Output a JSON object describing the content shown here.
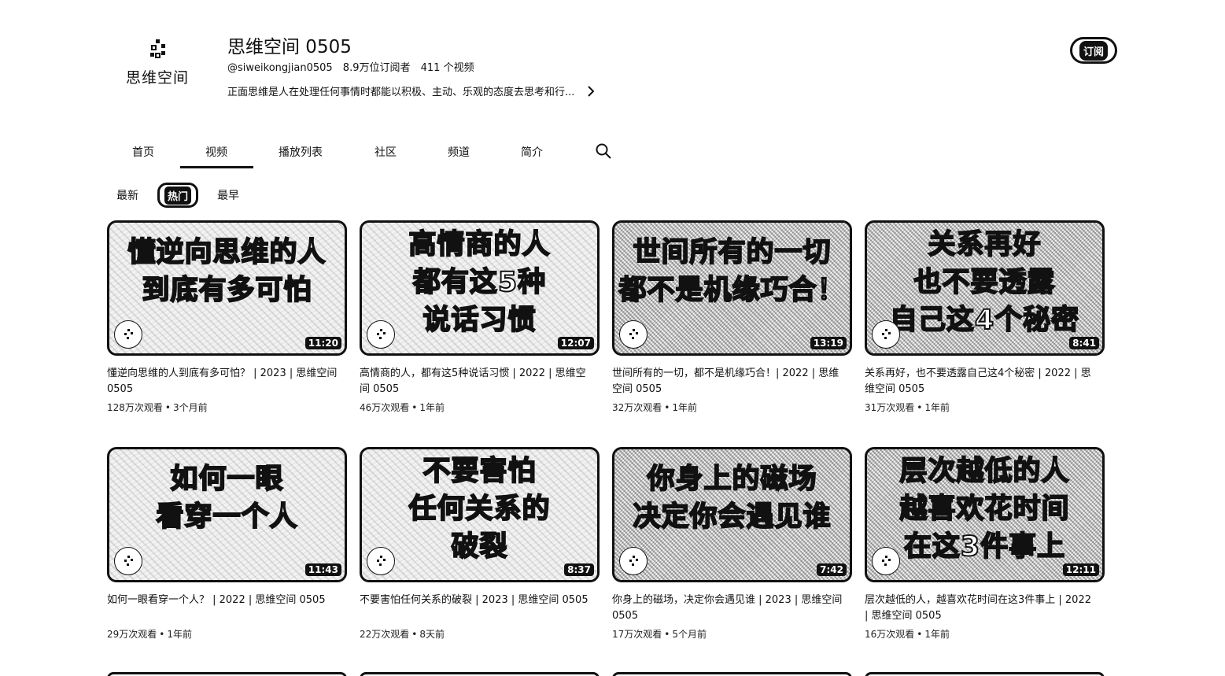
{
  "channel": {
    "logo_text": "思维空间",
    "title": "思维空间 0505",
    "handle": "@siweikongjian0505",
    "subscribers": "8.9万位订阅者",
    "video_count": "411 个视频",
    "description": "正面思维是人在处理任何事情时都能以积极、主动、乐观的态度去思考和行...",
    "subscribe_label": "订阅"
  },
  "tabs": [
    {
      "label": "首页"
    },
    {
      "label": "视频",
      "active": true
    },
    {
      "label": "播放列表"
    },
    {
      "label": "社区"
    },
    {
      "label": "频道"
    },
    {
      "label": "简介"
    }
  ],
  "sort": {
    "latest": "最新",
    "popular": "热门",
    "oldest": "最早"
  },
  "videos": [
    {
      "thumb_lines": [
        "懂逆向思维的人",
        "到底有多可怕"
      ],
      "duration": "11:20",
      "title": "懂逆向思维的人到底有多可怕？ | 2023 | 思维空间 0505",
      "views": "128万次观看",
      "age": "3个月前"
    },
    {
      "thumb_lines": [
        "高情商的人",
        "都有这5种",
        "说话习惯"
      ],
      "duration": "12:07",
      "title": "高情商的人，都有这5种说话习惯 | 2022 | 思维空间 0505",
      "views": "46万次观看",
      "age": "1年前"
    },
    {
      "thumb_lines": [
        "世间所有的一切",
        "都不是机缘巧合！"
      ],
      "duration": "13:19",
      "title": "世间所有的一切，都不是机缘巧合！| 2022 | 思维空间 0505",
      "views": "32万次观看",
      "age": "1年前"
    },
    {
      "thumb_lines": [
        "关系再好",
        "也不要透露",
        "自己这4个秘密"
      ],
      "duration": "8:41",
      "title": "关系再好，也不要透露自己这4个秘密 | 2022 | 思维空间 0505",
      "views": "31万次观看",
      "age": "1年前"
    },
    {
      "thumb_lines": [
        "如何一眼",
        "看穿一个人"
      ],
      "duration": "11:43",
      "title": "如何一眼看穿一个人？ | 2022 | 思维空间 0505",
      "views": "29万次观看",
      "age": "1年前"
    },
    {
      "thumb_lines": [
        "不要害怕",
        "任何关系的",
        "破裂"
      ],
      "duration": "8:37",
      "title": "不要害怕任何关系的破裂 | 2023 | 思维空间 0505",
      "views": "22万次观看",
      "age": "8天前"
    },
    {
      "thumb_lines": [
        "你身上的磁场",
        "决定你会遇见谁"
      ],
      "duration": "7:42",
      "title": "你身上的磁场，决定你会遇见谁 | 2023 | 思维空间 0505",
      "views": "17万次观看",
      "age": "5个月前"
    },
    {
      "thumb_lines": [
        "层次越低的人",
        "越喜欢花时间",
        "在这3件事上"
      ],
      "duration": "12:11",
      "title": "层次越低的人，越喜欢花时间在这3件事上 | 2022 | 思维空间 0505",
      "views": "16万次观看",
      "age": "1年前"
    }
  ],
  "meta_separator": "•",
  "icons": {
    "search": "search-icon",
    "chevron": "chevron-right-icon",
    "logo": "channel-logo-icon"
  }
}
